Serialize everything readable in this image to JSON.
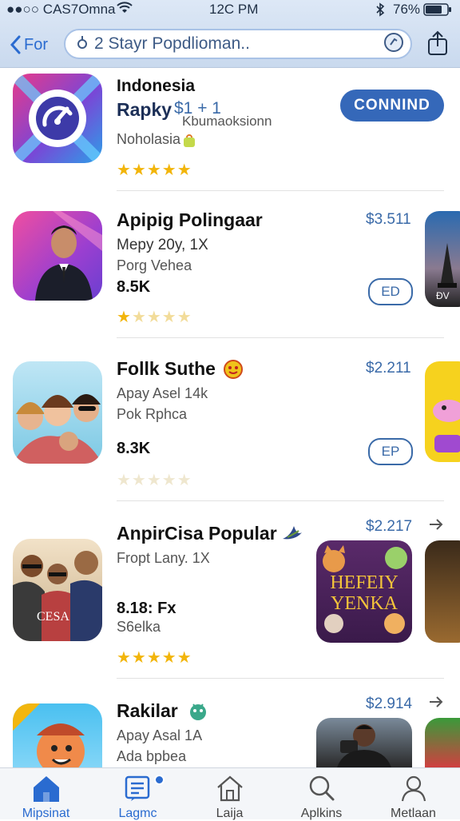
{
  "status_bar": {
    "carrier": "●●○○ CAS7Omna",
    "time": "12C PM",
    "battery": "76%"
  },
  "nav": {
    "back_label": "For",
    "search_value": "2 Stayr Popdlioman.."
  },
  "apps": [
    {
      "name": "Indonesia",
      "subtitle": "Rapky",
      "price": "$1 + 1",
      "note": "Kbumaoksionn",
      "developer": "Noholasia",
      "rating": 5,
      "button": "CONNIND"
    },
    {
      "name": "Apipig Polingaar",
      "line1": "Mepy 20y, 1X",
      "line2": "Porg Vehea",
      "count": "8.5K",
      "price": "$3.511",
      "rating": 1,
      "button": "ED"
    },
    {
      "name": "Follk Suthe",
      "line1": "Apay Asel 14k",
      "line2": "Pok Rphca",
      "count": "8.3K",
      "price": "$2.211",
      "rating": 0,
      "button": "EP"
    },
    {
      "name": "AnpirCisa Popular",
      "line1": "Fropt Lany. 1X",
      "count": "8.18: Fx",
      "line2": "S6elka",
      "price": "$2.217",
      "rating": 5,
      "poster_text": "HEFEIY YENKA",
      "icon_text": "CESA"
    },
    {
      "name": "Rakilar",
      "line1": "Apay Asal 1A",
      "line2": "Ada bpbea",
      "price": "$2.914"
    }
  ],
  "tabs": [
    {
      "label": "Mipsinat",
      "icon": "home-icon",
      "active": true
    },
    {
      "label": "Lagmc",
      "icon": "news-icon",
      "active": false
    },
    {
      "label": "Laija",
      "icon": "house-outline-icon",
      "active": false
    },
    {
      "label": "Aplkins",
      "icon": "search-icon",
      "active": false
    },
    {
      "label": "Metlaan",
      "icon": "person-icon",
      "active": false
    }
  ],
  "colors": {
    "accent": "#3568b9",
    "star": "#f2b50b",
    "header": "#d6e3f3"
  }
}
